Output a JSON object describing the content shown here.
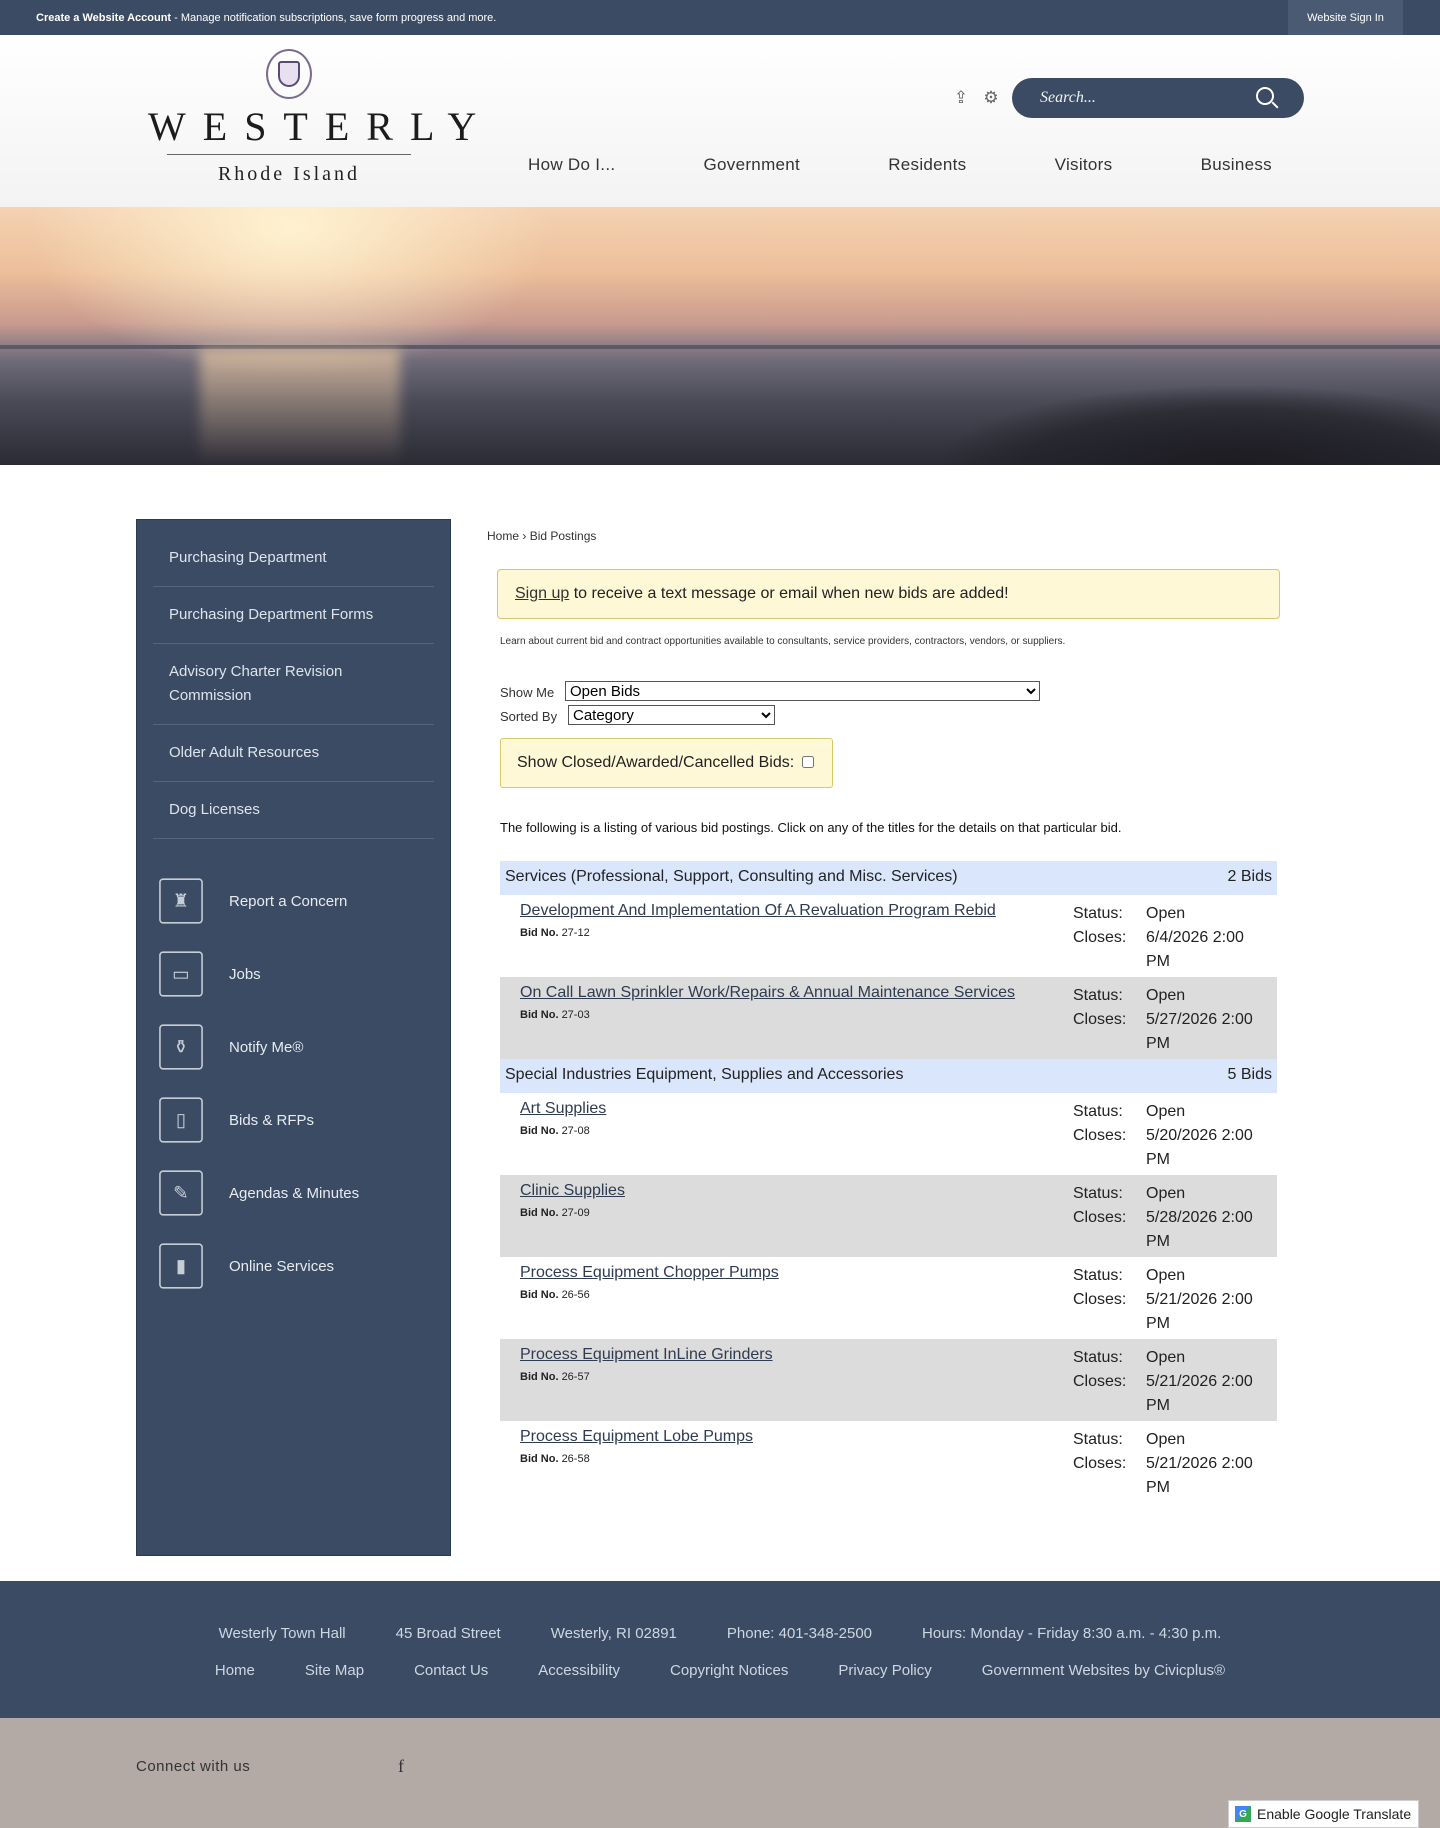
{
  "topbar": {
    "create_link": "Create a Website Account",
    "message": " - Manage notification subscriptions, save form progress and more.",
    "signin": "Website Sign In"
  },
  "logo": {
    "main": "WESTERLY",
    "sub": "Rhode Island"
  },
  "search": {
    "placeholder": "Search..."
  },
  "nav": [
    "How Do I...",
    "Government",
    "Residents",
    "Visitors",
    "Business"
  ],
  "sidebar": {
    "items": [
      "Purchasing Department",
      "Purchasing Department Forms",
      "Advisory Charter Revision Commission",
      "Older Adult Resources",
      "Dog Licenses"
    ],
    "quick_links": [
      {
        "label": "Report a Concern",
        "icon": "lighthouse-icon"
      },
      {
        "label": "Jobs",
        "icon": "suitcase-icon"
      },
      {
        "label": "Notify Me®",
        "icon": "bottle-icon"
      },
      {
        "label": "Bids & RFPs",
        "icon": "scroll-icon"
      },
      {
        "label": "Agendas & Minutes",
        "icon": "quill-icon"
      },
      {
        "label": "Online Services",
        "icon": "phone-icon"
      }
    ]
  },
  "breadcrumb": {
    "home": "Home",
    "sep": " › ",
    "current": "Bid Postings"
  },
  "notice": {
    "link": "Sign up",
    "text": " to receive a text message or email when new bids are added!"
  },
  "intro": "Learn about current bid and contract opportunities available to consultants, service providers, contractors, vendors, or suppliers.",
  "filters": {
    "show_me_label": "Show Me",
    "show_me_value": "Open Bids",
    "sorted_by_label": "Sorted By",
    "sorted_by_value": "Category",
    "closed_label": "Show Closed/Awarded/Cancelled Bids:"
  },
  "listing_text": "The following is a listing of various bid postings. Click on any of the titles for the details on that particular bid.",
  "labels": {
    "status": "Status:",
    "closes": "Closes:",
    "bid_no": "Bid No."
  },
  "categories": [
    {
      "name": "Services (Professional, Support, Consulting and Misc. Services)",
      "count": "2 Bids",
      "bids": [
        {
          "title": "Development And Implementation Of A Revaluation Program Rebid",
          "bid_no": "27-12",
          "status": "Open",
          "closes": "6/4/2026 2:00 PM"
        },
        {
          "title": "On Call Lawn Sprinkler Work/Repairs & Annual Maintenance Services",
          "bid_no": "27-03",
          "status": "Open",
          "closes": "5/27/2026 2:00 PM"
        }
      ]
    },
    {
      "name": "Special Industries Equipment, Supplies and Accessories",
      "count": "5 Bids",
      "bids": [
        {
          "title": "Art Supplies",
          "bid_no": "27-08",
          "status": "Open",
          "closes": "5/20/2026 2:00 PM"
        },
        {
          "title": "Clinic Supplies",
          "bid_no": "27-09",
          "status": "Open",
          "closes": "5/28/2026 2:00 PM"
        },
        {
          "title": "Process Equipment Chopper Pumps",
          "bid_no": "26-56",
          "status": "Open",
          "closes": "5/21/2026 2:00 PM"
        },
        {
          "title": "Process Equipment InLine Grinders",
          "bid_no": "26-57",
          "status": "Open",
          "closes": "5/21/2026 2:00 PM"
        },
        {
          "title": "Process Equipment Lobe Pumps",
          "bid_no": "26-58",
          "status": "Open",
          "closes": "5/21/2026 2:00 PM"
        }
      ]
    }
  ],
  "footer": {
    "info": [
      "Westerly Town Hall",
      "45 Broad Street",
      "Westerly, RI 02891",
      "Phone: 401-348-2500",
      "Hours: Monday - Friday 8:30 a.m. - 4:30 p.m."
    ],
    "links": [
      "Home",
      "Site Map",
      "Contact Us",
      "Accessibility",
      "Copyright Notices",
      "Privacy Policy",
      "Government Websites by Civicplus®"
    ]
  },
  "connect": {
    "label": "Connect with us"
  },
  "translate": {
    "label": "Enable Google Translate"
  }
}
